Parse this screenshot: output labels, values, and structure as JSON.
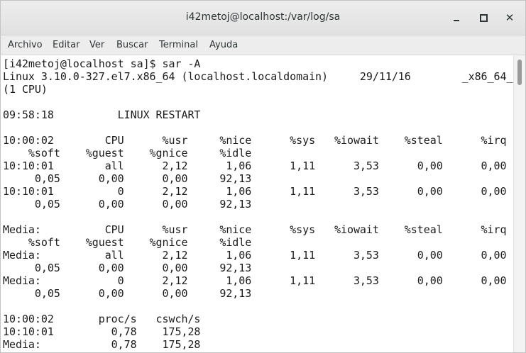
{
  "window": {
    "title": "i42metoj@localhost:/var/log/sa",
    "minimize_glyph": "",
    "maximize_glyph": "",
    "close_glyph": "✕"
  },
  "menu": [
    "Archivo",
    "Editar",
    "Ver",
    "Buscar",
    "Terminal",
    "Ayuda"
  ],
  "terminal": {
    "lines": [
      "[i42metoj@localhost sa]$ sar -A",
      "Linux 3.10.0-327.el7.x86_64 (localhost.localdomain)     29/11/16        _x86_64_",
      "(1 CPU)",
      "",
      "09:58:18          LINUX RESTART",
      "",
      "10:00:02        CPU      %usr     %nice      %sys   %iowait    %steal      %irq",
      "    %soft    %guest    %gnice     %idle",
      "10:10:01        all      2,12      1,06      1,11      3,53      0,00      0,00",
      "     0,05      0,00      0,00     92,13",
      "10:10:01          0      2,12      1,06      1,11      3,53      0,00      0,00",
      "     0,05      0,00      0,00     92,13",
      "",
      "Media:          CPU      %usr     %nice      %sys   %iowait    %steal      %irq",
      "    %soft    %guest    %gnice     %idle",
      "Media:          all      2,12      1,06      1,11      3,53      0,00      0,00",
      "     0,05      0,00      0,00     92,13",
      "Media:            0      2,12      1,06      1,11      3,53      0,00      0,00",
      "     0,05      0,00      0,00     92,13",
      "",
      "10:00:02       proc/s   cswch/s",
      "10:10:01         0,78    175,28",
      "Media:           0,78    175,28"
    ]
  },
  "colors": {
    "titlebar": "#e6e6e6",
    "menubar": "#ededed",
    "terminal_bg": "#ffffff",
    "terminal_fg": "#1c1c1c"
  }
}
